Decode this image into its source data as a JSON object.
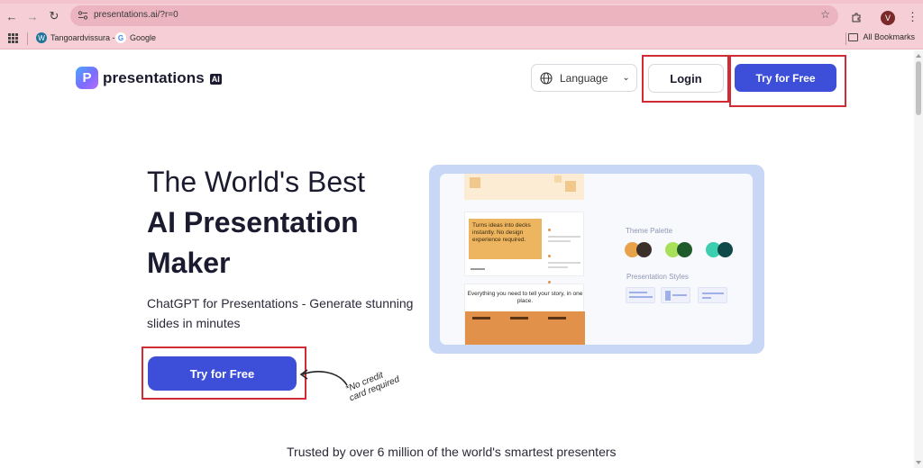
{
  "browser": {
    "url": "presentations.ai/?r=0",
    "avatar_letter": "V",
    "bookmarks": [
      {
        "label": "Tangoardvissura -",
        "icon": "wordpress-icon"
      },
      {
        "label": "Google",
        "icon": "google-icon"
      }
    ],
    "all_bookmarks": "All Bookmarks"
  },
  "header": {
    "logo_text": "presentations",
    "logo_suffix": "AI",
    "language_label": "Language",
    "login_label": "Login",
    "try_label": "Try for Free"
  },
  "hero": {
    "title_line1": "The World's Best",
    "title_line2": "AI Presentation",
    "title_line3": "Maker",
    "subtitle": "ChatGPT for Presentations - Generate stunning slides in minutes",
    "cta_label": "Try for Free",
    "no_credit_line1": "*No credit",
    "no_credit_line2": "card required"
  },
  "preview": {
    "slide2_text": "Turns ideas into decks instantly. No design experience required.",
    "slide3_text": "Everything you need to tell your story, in one place.",
    "palette_title": "Theme Palette",
    "styles_title": "Presentation Styles",
    "palette_colors": [
      "#e8a24a",
      "#3b2f2a",
      "#a9e05a",
      "#1f5a2a",
      "#3bcfb0",
      "#0f4a48"
    ]
  },
  "footer": {
    "trusted": "Trusted by over 6 million of the world's smartest presenters"
  },
  "colors": {
    "accent": "#3d4fd9",
    "highlight": "#d12b36",
    "chrome": "#f6cfd6"
  }
}
